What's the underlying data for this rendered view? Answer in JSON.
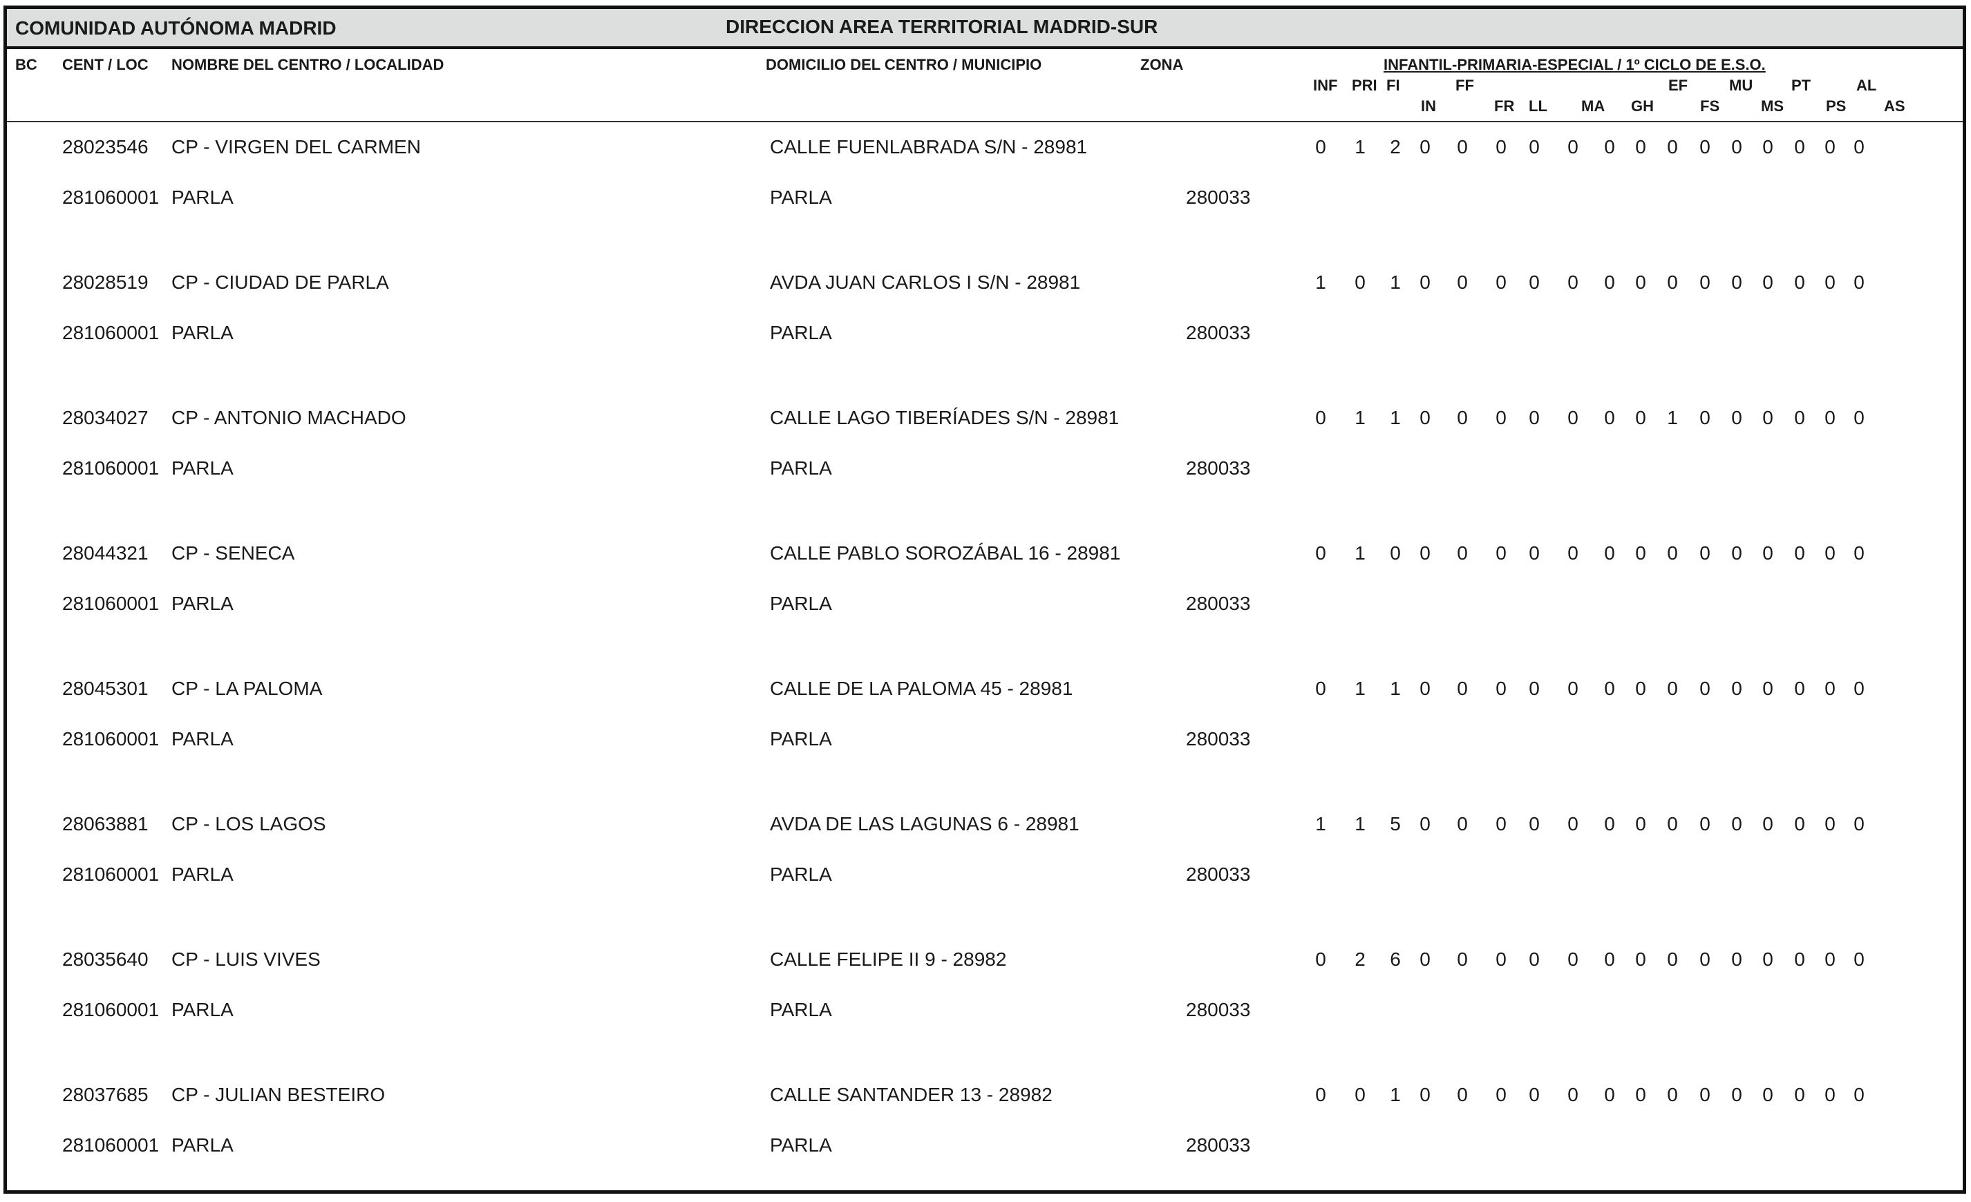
{
  "report": {
    "community": "COMUNIDAD AUTÓNOMA MADRID",
    "direction": "DIRECCION AREA TERRITORIAL MADRID-SUR"
  },
  "headers": {
    "bc": "BC",
    "cent_loc": "CENT / LOC",
    "nombre": "NOMBRE DEL CENTRO / LOCALIDAD",
    "domicilio": "DOMICILIO DEL CENTRO / MUNICIPIO",
    "zona": "ZONA",
    "group": "INFANTIL-PRIMARIA-ESPECIAL / 1º CICLO DE E.S.O.",
    "codes": [
      "INF",
      "PRI",
      "FI",
      "IN",
      "FF",
      "FR",
      "LL",
      "MA",
      "GH",
      "EF",
      "FS",
      "MU",
      "MS",
      "PT",
      "PS",
      "AL",
      "AS"
    ]
  },
  "rows": [
    {
      "code": "28023546",
      "name": "CP - VIRGEN DEL CARMEN",
      "address": "CALLE FUENLABRADA S/N - 28981",
      "loc_code": "281060001",
      "locality": "PARLA",
      "municipality": "PARLA",
      "zone": "280033",
      "values": [
        "0",
        "1",
        "2",
        "0",
        "0",
        "0",
        "0",
        "0",
        "0",
        "0",
        "0",
        "0",
        "0",
        "0",
        "0",
        "0",
        "0"
      ]
    },
    {
      "code": "28028519",
      "name": "CP - CIUDAD DE PARLA",
      "address": "AVDA JUAN CARLOS I S/N - 28981",
      "loc_code": "281060001",
      "locality": "PARLA",
      "municipality": "PARLA",
      "zone": "280033",
      "values": [
        "1",
        "0",
        "1",
        "0",
        "0",
        "0",
        "0",
        "0",
        "0",
        "0",
        "0",
        "0",
        "0",
        "0",
        "0",
        "0",
        "0"
      ]
    },
    {
      "code": "28034027",
      "name": "CP - ANTONIO MACHADO",
      "address": "CALLE LAGO TIBERÍADES S/N - 28981",
      "loc_code": "281060001",
      "locality": "PARLA",
      "municipality": "PARLA",
      "zone": "280033",
      "values": [
        "0",
        "1",
        "1",
        "0",
        "0",
        "0",
        "0",
        "0",
        "0",
        "0",
        "1",
        "0",
        "0",
        "0",
        "0",
        "0",
        "0"
      ]
    },
    {
      "code": "28044321",
      "name": "CP - SENECA",
      "address": "CALLE PABLO SOROZÁBAL 16 - 28981",
      "loc_code": "281060001",
      "locality": "PARLA",
      "municipality": "PARLA",
      "zone": "280033",
      "values": [
        "0",
        "1",
        "0",
        "0",
        "0",
        "0",
        "0",
        "0",
        "0",
        "0",
        "0",
        "0",
        "0",
        "0",
        "0",
        "0",
        "0"
      ]
    },
    {
      "code": "28045301",
      "name": "CP - LA PALOMA",
      "address": "CALLE DE LA PALOMA 45 - 28981",
      "loc_code": "281060001",
      "locality": "PARLA",
      "municipality": "PARLA",
      "zone": "280033",
      "values": [
        "0",
        "1",
        "1",
        "0",
        "0",
        "0",
        "0",
        "0",
        "0",
        "0",
        "0",
        "0",
        "0",
        "0",
        "0",
        "0",
        "0"
      ]
    },
    {
      "code": "28063881",
      "name": "CP - LOS LAGOS",
      "address": "AVDA DE LAS LAGUNAS 6 - 28981",
      "loc_code": "281060001",
      "locality": "PARLA",
      "municipality": "PARLA",
      "zone": "280033",
      "values": [
        "1",
        "1",
        "5",
        "0",
        "0",
        "0",
        "0",
        "0",
        "0",
        "0",
        "0",
        "0",
        "0",
        "0",
        "0",
        "0",
        "0"
      ]
    },
    {
      "code": "28035640",
      "name": "CP - LUIS VIVES",
      "address": "CALLE FELIPE II 9 - 28982",
      "loc_code": "281060001",
      "locality": "PARLA",
      "municipality": "PARLA",
      "zone": "280033",
      "values": [
        "0",
        "2",
        "6",
        "0",
        "0",
        "0",
        "0",
        "0",
        "0",
        "0",
        "0",
        "0",
        "0",
        "0",
        "0",
        "0",
        "0"
      ]
    },
    {
      "code": "28037685",
      "name": "CP - JULIAN BESTEIRO",
      "address": "CALLE SANTANDER 13 - 28982",
      "loc_code": "281060001",
      "locality": "PARLA",
      "municipality": "PARLA",
      "zone": "280033",
      "values": [
        "0",
        "0",
        "1",
        "0",
        "0",
        "0",
        "0",
        "0",
        "0",
        "0",
        "0",
        "0",
        "0",
        "0",
        "0",
        "0",
        "0"
      ]
    }
  ]
}
